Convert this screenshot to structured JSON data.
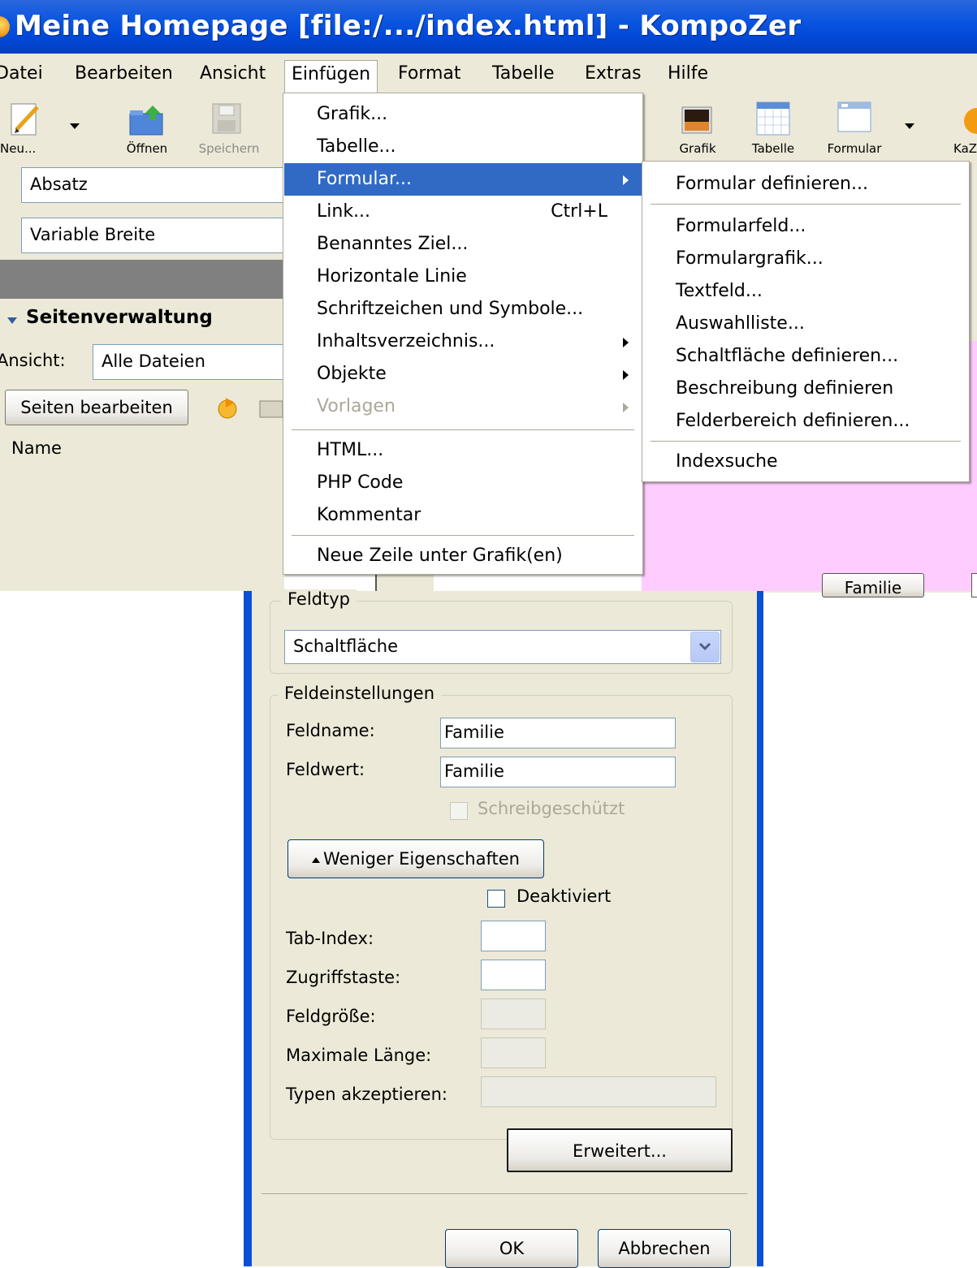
{
  "window": {
    "title": "Meine Homepage [file:/.../index.html] - KompoZer"
  },
  "menubar": {
    "items": [
      "Datei",
      "Bearbeiten",
      "Ansicht",
      "Einfügen",
      "Format",
      "Tabelle",
      "Extras",
      "Hilfe"
    ]
  },
  "toolbar": {
    "left": [
      {
        "label": "Neu...",
        "icon": "new-document-icon"
      },
      {
        "label": "Öffnen",
        "icon": "open-folder-icon"
      },
      {
        "label": "Speichern",
        "icon": "save-disk-icon",
        "disabled": true
      }
    ],
    "right": [
      {
        "label": "Grafik",
        "icon": "image-icon"
      },
      {
        "label": "Tabelle",
        "icon": "table-icon"
      },
      {
        "label": "Formular",
        "icon": "form-icon"
      },
      {
        "label": "KaZ",
        "icon": "kazoo-icon"
      }
    ]
  },
  "format": {
    "paragraph_style": "Absatz",
    "font": "Variable Breite"
  },
  "site_panel": {
    "title": "Seitenverwaltung",
    "view_label": "Ansicht:",
    "view_value": "Alle Dateien",
    "edit_button": "Seiten bearbeiten",
    "column_name": "Name"
  },
  "insert_menu": {
    "items": [
      {
        "label": "Grafik..."
      },
      {
        "label": "Tabelle..."
      },
      {
        "label": "Formular...",
        "submenu": true,
        "selected": true
      },
      {
        "label": "Link...",
        "shortcut": "Ctrl+L"
      },
      {
        "label": "Benanntes Ziel..."
      },
      {
        "label": "Horizontale Linie"
      },
      {
        "label": "Schriftzeichen und Symbole..."
      },
      {
        "label": "Inhaltsverzeichnis...",
        "submenu": true
      },
      {
        "label": "Objekte",
        "submenu": true
      },
      {
        "label": "Vorlagen",
        "submenu": true,
        "disabled": true
      },
      {
        "label": "HTML..."
      },
      {
        "label": "PHP Code"
      },
      {
        "label": "Kommentar"
      },
      {
        "label": "Neue Zeile unter Grafik(en)"
      }
    ]
  },
  "form_submenu": {
    "items": [
      "Formular definieren...",
      "Formularfeld...",
      "Formulargrafik...",
      "Textfeld...",
      "Auswahlliste...",
      "Schaltfläche definieren...",
      "Beschreibung definieren",
      "Felderbereich definieren...",
      "Indexsuche"
    ]
  },
  "page_button": "Familie",
  "dialog": {
    "fieldtype_group": "Feldtyp",
    "fieldtype_value": "Schaltfläche",
    "settings_group": "Feldeinstellungen",
    "fieldname_label": "Feldname:",
    "fieldname_value": "Familie",
    "fieldvalue_label": "Feldwert:",
    "fieldvalue_value": "Familie",
    "readonly_label": "Schreibgeschützt",
    "less_props_button": "Weniger Eigenschaften",
    "disabled_label": "Deaktiviert",
    "tabindex_label": "Tab-Index:",
    "accesskey_label": "Zugriffstaste:",
    "fieldsize_label": "Feldgröße:",
    "maxlength_label": "Maximale Länge:",
    "accept_label": "Typen akzeptieren:",
    "advanced_button": "Erweitert...",
    "ok_button": "OK",
    "cancel_button": "Abbrechen"
  }
}
